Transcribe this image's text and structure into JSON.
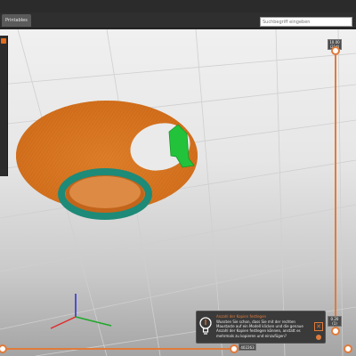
{
  "tabs": {
    "active_label": "Printables"
  },
  "search": {
    "placeholder": "Suchbegriff eingeben"
  },
  "vertical_slider": {
    "top_value": "10.00",
    "top_layer": "(214)",
    "bottom_value": "0.20",
    "bottom_layer": "(1)"
  },
  "horizontal_slider": {
    "value": "402263"
  },
  "tooltip": {
    "title": "Anzahl der Kopien festlegen",
    "body": "Wussten Sie schon, dass Sie mit der rechten Maustaste auf ein Modell klicken und die genaue Anzahl der Kopien festlegen können, anstatt es mehrmals zu kopieren und einzufügen?",
    "close_icon": "close-icon",
    "settings_icon": "gear-icon"
  },
  "colors": {
    "accent": "#e07b3b",
    "model_orange": "#d9741e",
    "ring_teal": "#1e8a78",
    "support_green": "#22c33a"
  }
}
